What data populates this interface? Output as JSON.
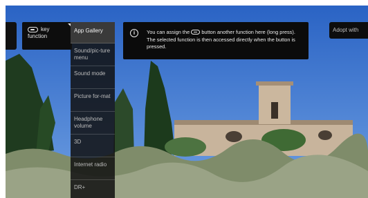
{
  "left_tile": {
    "label": ""
  },
  "key_tile": {
    "line1": "key",
    "line2": "function"
  },
  "menu": {
    "items": [
      {
        "label": "App Gallery"
      },
      {
        "label": "Sound/pic-ture menu"
      },
      {
        "label": "Sound mode"
      },
      {
        "label": "Picture for-mat"
      },
      {
        "label": "Headphone volume"
      },
      {
        "label": "3D"
      },
      {
        "label": "Internet radio"
      },
      {
        "label": "DR+"
      }
    ]
  },
  "info": {
    "icon": "i",
    "text_before_key": "You can assign the",
    "text_after_key": "button another function here (long press). The selected function is then accessed directly when the button is pressed."
  },
  "adopt_button": {
    "label": "Adopt with"
  },
  "colors": {
    "panel": "#0b0b0b",
    "menu_selected": "#3a3a3a",
    "sky": "#2f69c8"
  }
}
